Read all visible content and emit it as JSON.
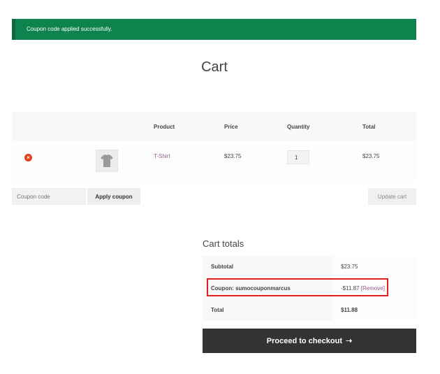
{
  "notice": {
    "message": "Coupon code applied successfully."
  },
  "page": {
    "title": "Cart"
  },
  "cart": {
    "headers": {
      "product": "Product",
      "price": "Price",
      "quantity": "Quantity",
      "total": "Total"
    },
    "items": [
      {
        "remove_glyph": "×",
        "product": "T-Shirt",
        "price": "$23.75",
        "quantity": "1",
        "total": "$23.75"
      }
    ],
    "coupon_placeholder": "Coupon code",
    "apply_label": "Apply coupon",
    "update_label": "Update cart"
  },
  "totals": {
    "title": "Cart totals",
    "subtotal_label": "Subtotal",
    "subtotal_value": "$23.75",
    "coupon_label": "Coupon: sumocouponmarcus",
    "coupon_value": "-$11.87",
    "coupon_remove": "[Remove]",
    "total_label": "Total",
    "total_value": "$11.88",
    "checkout_label": "Proceed to checkout",
    "checkout_arrow": "➝"
  },
  "colors": {
    "notice": "#0f834d",
    "link": "#96588a",
    "remove": "#e2401c",
    "highlight": "#e02020"
  }
}
